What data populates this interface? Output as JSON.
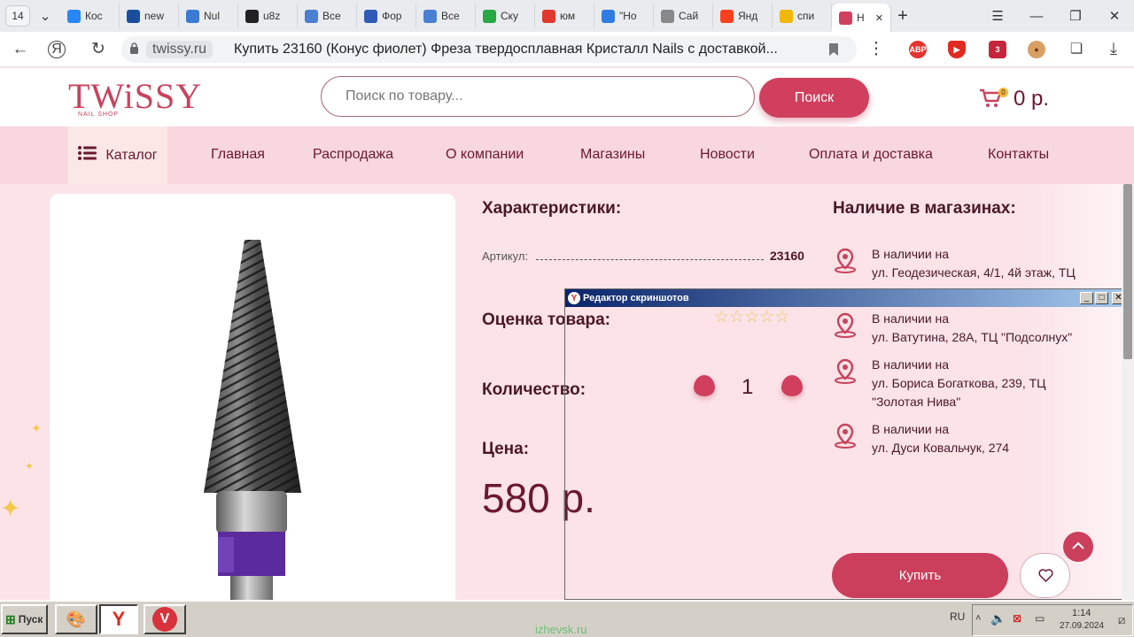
{
  "browser": {
    "tab_count": "14",
    "tabs": [
      {
        "label": "Кос",
        "icon": "vk-icon",
        "color": "#2787f5"
      },
      {
        "label": "new",
        "icon": "chart-icon",
        "color": "#1a4e9c"
      },
      {
        "label": "Nul",
        "icon": "nul-icon",
        "color": "#3b7bd4"
      },
      {
        "label": "u8z",
        "icon": "star-icon",
        "color": "#222222"
      },
      {
        "label": "Все",
        "icon": "s-icon",
        "color": "#4a7fd1"
      },
      {
        "label": "Фор",
        "icon": "shield-icon",
        "color": "#2f5ab5"
      },
      {
        "label": "Все",
        "icon": "s-icon",
        "color": "#4a7fd1"
      },
      {
        "label": "Ску",
        "icon": "sku-icon",
        "color": "#27a845"
      },
      {
        "label": "юм",
        "icon": "yum-icon",
        "color": "#e03a2f"
      },
      {
        "label": "\"Но",
        "icon": "q-icon",
        "color": "#2f7de1"
      },
      {
        "label": "Сай",
        "icon": "page-icon",
        "color": "#888888"
      },
      {
        "label": "Янд",
        "icon": "yandex-icon",
        "color": "#fc3f1d"
      },
      {
        "label": "спи",
        "icon": "sun-icon",
        "color": "#f2b705"
      },
      {
        "label": "Н",
        "icon": "star-icon",
        "color": "#d0405e"
      }
    ],
    "host": "twissy.ru",
    "page_title": "Купить 23160 (Конус фиолет) Фреза твердосплавная Кристалл Nails с доставкой...",
    "extensions": [
      {
        "label": "ABP",
        "color": "#e3342f"
      },
      {
        "label": "",
        "color": "#e02b20"
      },
      {
        "label": "3",
        "color": "#c5253b"
      }
    ]
  },
  "site": {
    "logo": "TWiSSY",
    "logo_sub": "NAIL SHOP",
    "search_placeholder": "Поиск по товару...",
    "search_button": "Поиск",
    "cart_count": "0",
    "cart_total": "0 р.",
    "menu": [
      "Каталог",
      "Главная",
      "Распродажа",
      "О компании",
      "Магазины",
      "Новости",
      "Оплата и доставка",
      "Контакты"
    ]
  },
  "product": {
    "chars_title": "Характеристики:",
    "article_label": "Артикул:",
    "article_value": "23160",
    "rating_label": "Оценка товара:",
    "rating": 0,
    "quantity_label": "Количество:",
    "quantity": "1",
    "price_label": "Цена:",
    "price": "580 р.",
    "buy_button": "Купить",
    "stores_title": "Наличие в магазинах:",
    "stores": [
      {
        "status": "В наличии на",
        "address": "ул. Геодезическая, 4/1, 4й этаж, ТЦ"
      },
      {
        "status": "В наличии на",
        "address": "ул. Ватутина, 28А, ТЦ \"Подсолнух\""
      },
      {
        "status": "В наличии на",
        "address": "ул. Бориса Богаткова, 239, ТЦ \"Золотая Нива\""
      },
      {
        "status": "В наличии на",
        "address": "ул. Дуси Ковальчук, 274"
      }
    ]
  },
  "popup": {
    "title": "Редактор скриншотов"
  },
  "taskbar": {
    "start": "Пуск",
    "lang": "RU",
    "time": "1:14",
    "date": "27.09.2024",
    "watermark": "izhevsk.ru"
  }
}
